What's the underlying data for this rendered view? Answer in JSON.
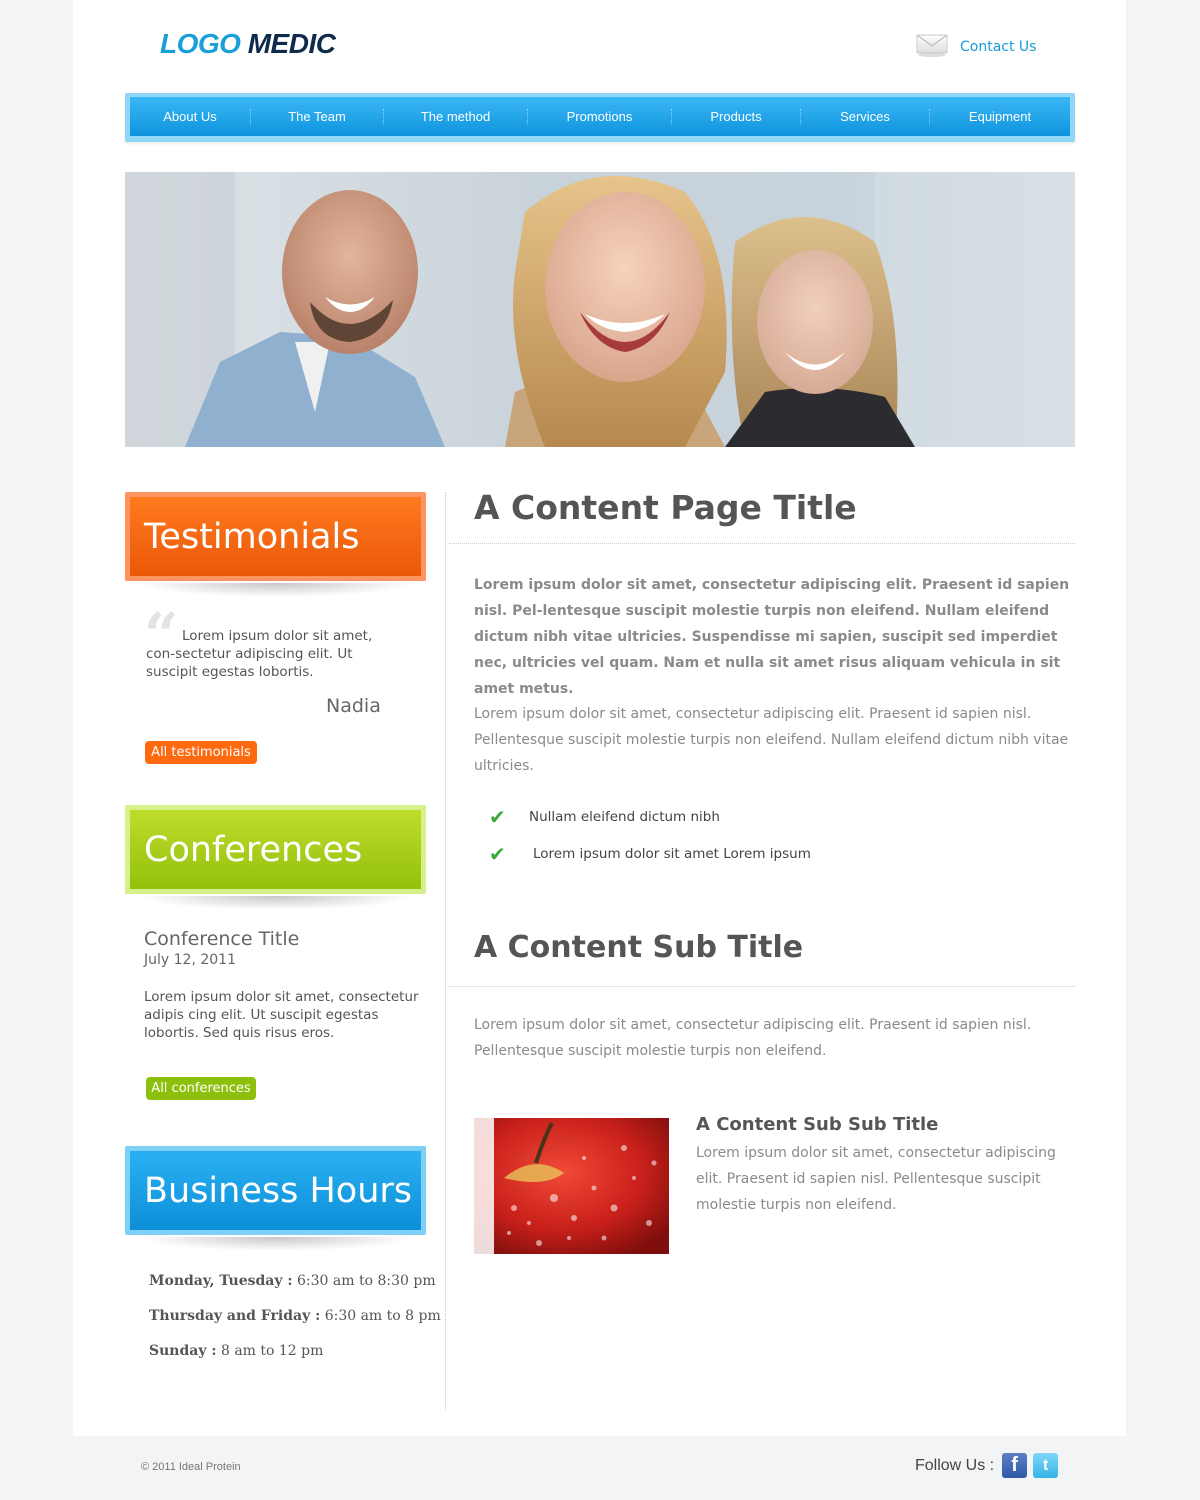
{
  "header": {
    "logo_part1": "LOGO",
    "logo_part2": "MEDIC",
    "contact_label": "Contact Us",
    "contact_icon": "envelope-icon"
  },
  "nav": {
    "items": [
      {
        "label": "About Us"
      },
      {
        "label": "The Team"
      },
      {
        "label": "The method"
      },
      {
        "label": "Promotions"
      },
      {
        "label": "Products"
      },
      {
        "label": "Services"
      },
      {
        "label": "Equipment"
      }
    ]
  },
  "sidebar": {
    "testimonials": {
      "title": "Testimonials",
      "quote": "Lorem ipsum dolor sit amet, con-sectetur adipiscing elit. Ut suscipit egestas lobortis.",
      "author": "Nadia",
      "button": "All testimonials"
    },
    "conferences": {
      "title": "Conferences",
      "item_title": "Conference Title",
      "item_date": "July 12, 2011",
      "item_text": "Lorem ipsum dolor sit amet, consectetur adipis cing elit. Ut suscipit egestas lobortis. Sed quis risus eros.",
      "button": "All conferences"
    },
    "business_hours": {
      "title": "Business Hours",
      "rows": [
        {
          "days": "Monday, Tuesday :",
          "hours": " 6:30 am to 8:30 pm"
        },
        {
          "days": "Thursday and Friday :",
          "hours": " 6:30 am to 8 pm"
        },
        {
          "days": "Sunday :",
          "hours": " 8 am to 12 pm"
        }
      ]
    }
  },
  "main": {
    "page_title": "A Content Page Title",
    "lead": "Lorem ipsum dolor sit amet, consectetur adipiscing elit. Praesent id sapien nisl. Pel-lentesque suscipit molestie turpis non eleifend. Nullam eleifend dictum nibh vitae ultricies. Suspendisse mi sapien, suscipit sed imperdiet nec, ultricies vel quam. Nam et nulla sit amet risus aliquam vehicula in sit amet metus.",
    "paragraph": "Lorem ipsum dolor sit amet, consectetur adipiscing elit. Praesent id sapien nisl. Pellentesque suscipit molestie turpis non eleifend. Nullam eleifend dictum nibh vitae ultricies.",
    "checklist": [
      "Nullam eleifend dictum nibh",
      "Lorem ipsum dolor sit amet Lorem ipsum"
    ],
    "sub_title": "A Content Sub Title",
    "sub_paragraph": "Lorem ipsum dolor sit amet, consectetur adipiscing elit. Praesent id sapien nisl. Pellentesque suscipit molestie turpis non eleifend.",
    "sub_sub_title": "A Content Sub Sub Title",
    "sub_sub_paragraph": "Lorem ipsum dolor sit amet, consectetur adipiscing elit. Praesent id sapien nisl. Pellentesque suscipit molestie turpis non eleifend."
  },
  "footer": {
    "copyright": "© 2011 Ideal Protein",
    "follow_label": "Follow Us :",
    "facebook_glyph": "f",
    "twitter_glyph": "t"
  },
  "colors": {
    "accent_blue": "#1a9ad8",
    "testimonials_orange": "#ff6a10",
    "conferences_green": "#8cc00c",
    "business_blue": "#0d8fd8",
    "checkmark_green": "#3ca83c"
  }
}
